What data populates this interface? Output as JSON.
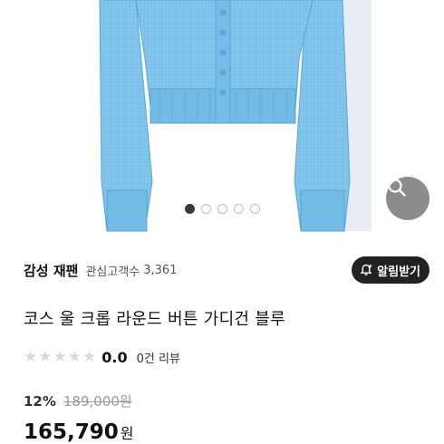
{
  "carousel": {
    "dots": [
      true,
      false,
      false,
      false,
      false
    ],
    "zoom_icon": "search-icon"
  },
  "brand": {
    "name": "감성 재팬",
    "followers_label": "관심고객수",
    "followers_count": "3,361",
    "notify_label": "알림받기",
    "notify_icon": "bell-plus-icon"
  },
  "product": {
    "title": "코스 울 크롭 라운드 버튼 가디건 블루",
    "rating": "0.0",
    "stars": 0,
    "reviews": "0건 리뷰",
    "discount": "12%",
    "original_price": "189,000원",
    "price": "165,790",
    "currency": "원"
  },
  "colors": {
    "cardigan": "#7fc3ea",
    "active_dot": "#3a3a3a",
    "notify_button": "#222222",
    "zoom_button": "#8c8c8c"
  }
}
